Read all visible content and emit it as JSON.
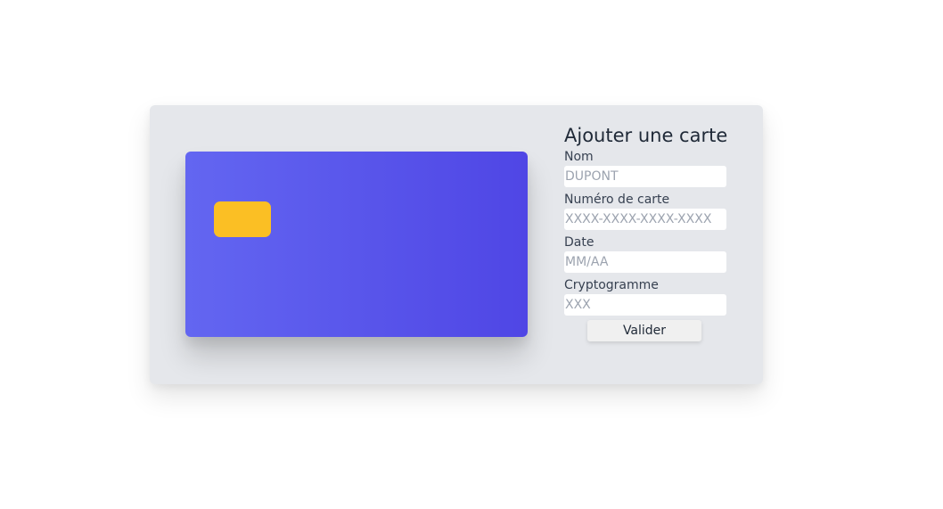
{
  "form": {
    "title": "Ajouter une carte",
    "fields": [
      {
        "label": "Nom",
        "placeholder": "DUPONT",
        "value": ""
      },
      {
        "label": "Numéro de carte",
        "placeholder": "XXXX-XXXX-XXXX-XXXX",
        "value": ""
      },
      {
        "label": "Date",
        "placeholder": "MM/AA",
        "value": ""
      },
      {
        "label": "Cryptogramme",
        "placeholder": "XXX",
        "value": ""
      }
    ],
    "submit_label": "Valider"
  },
  "card": {
    "gradient_start": "#6366f1",
    "gradient_end": "#4f46e5",
    "chip_color": "#fbbf24"
  },
  "colors": {
    "panel_background": "#e5e7eb",
    "page_background": "#ffffff"
  }
}
